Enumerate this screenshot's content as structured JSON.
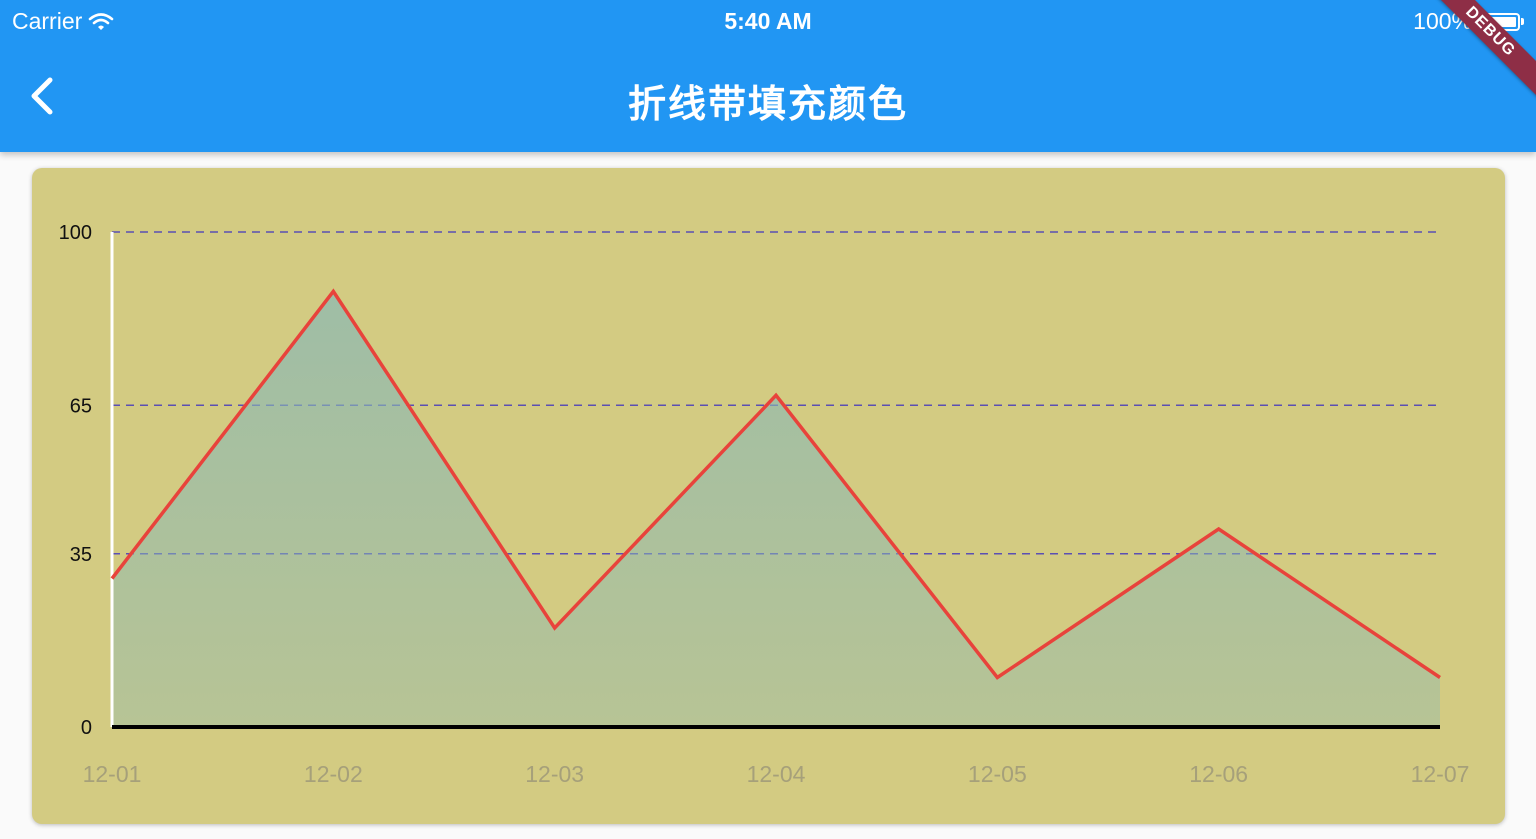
{
  "status_bar": {
    "carrier": "Carrier",
    "time": "5:40 AM",
    "battery": "100%"
  },
  "app_bar": {
    "title": "折线带填充颜色",
    "debug_badge": "DEBUG"
  },
  "colors": {
    "app_bar": "#2196f3",
    "card_background": "#d3cb82",
    "line": "#e8433b",
    "area_fill": "#8ab8b4",
    "grid_line": "#5b4fb3",
    "y_axis_line": "#ffffff",
    "x_axis_line": "#000000",
    "x_tick_label": "#a6a07a",
    "y_tick_label": "#111111",
    "debug_ribbon": "#8e2e46"
  },
  "chart_data": {
    "type": "area",
    "title": "",
    "xlabel": "",
    "ylabel": "",
    "categories": [
      "12-01",
      "12-02",
      "12-03",
      "12-04",
      "12-05",
      "12-06",
      "12-07"
    ],
    "series": [
      {
        "values": [
          30,
          88,
          20,
          67,
          10,
          40,
          10
        ]
      }
    ],
    "y_ticks": [
      "0",
      "35",
      "65",
      "100"
    ],
    "grid_values": [
      35,
      65,
      100
    ],
    "ylim": [
      0,
      100
    ],
    "grid": "horizontal dashed",
    "legend": "none"
  }
}
